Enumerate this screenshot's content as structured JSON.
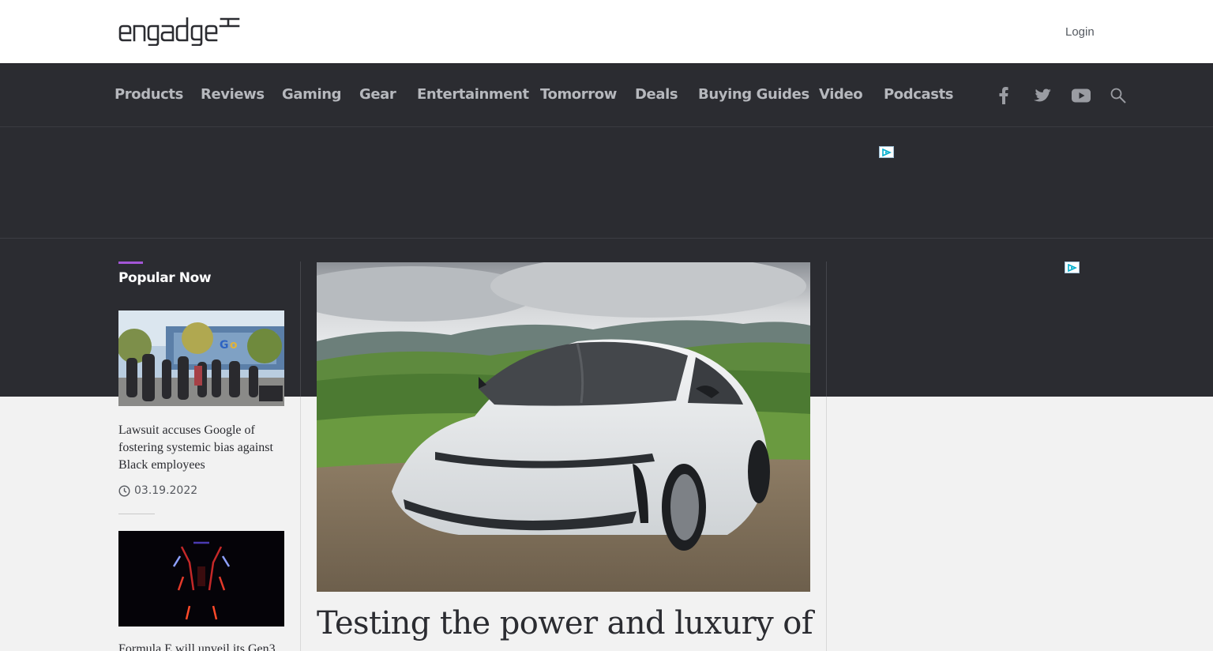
{
  "header": {
    "logo_text": "engadget",
    "login_label": "Login"
  },
  "nav": {
    "items": [
      {
        "label": "Products"
      },
      {
        "label": "Reviews"
      },
      {
        "label": "Gaming"
      },
      {
        "label": "Gear"
      },
      {
        "label": "Entertainment"
      },
      {
        "label": "Tomorrow"
      },
      {
        "label": "Deals"
      },
      {
        "label": "Buying Guides"
      },
      {
        "label": "Video"
      },
      {
        "label": "Podcasts"
      }
    ],
    "icons": [
      "facebook-icon",
      "twitter-icon",
      "youtube-icon",
      "search-icon"
    ]
  },
  "sidebar": {
    "title": "Popular Now",
    "stories": [
      {
        "title": "Lawsuit accuses Google of fostering systemic bias against Black employees",
        "date": "03.19.2022"
      },
      {
        "title": "Formula E will unveil its Gen3"
      }
    ]
  },
  "main": {
    "headline": "Testing the power and luxury of"
  },
  "colors": {
    "accent": "#a356d6",
    "nav_bg": "#2b2c31",
    "page_bg": "#f2f2f2"
  }
}
